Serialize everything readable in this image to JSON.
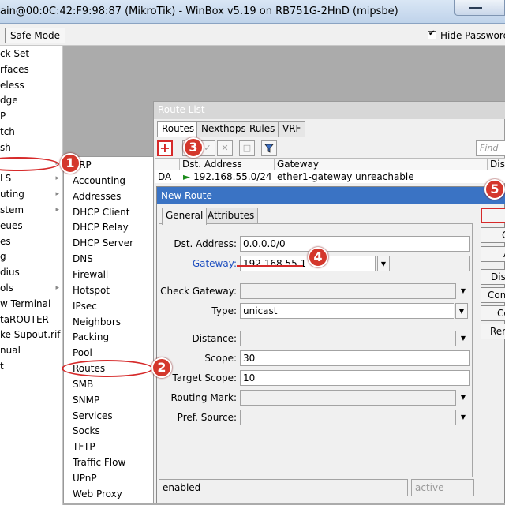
{
  "window": {
    "title": "ain@00:0C:42:F9:98:87 (MikroTik) - WinBox v5.19 on RB751G-2HnD (mipsbe)"
  },
  "toolbar": {
    "safe_mode": "Safe Mode",
    "hide_passwords": "Hide Password"
  },
  "sidebar": {
    "items": [
      {
        "label": "ck Set",
        "arrow": ""
      },
      {
        "label": "rfaces",
        "arrow": ""
      },
      {
        "label": "eless",
        "arrow": ""
      },
      {
        "label": "dge",
        "arrow": ""
      },
      {
        "label": "P",
        "arrow": ""
      },
      {
        "label": "tch",
        "arrow": ""
      },
      {
        "label": "sh",
        "arrow": ""
      },
      {
        "label": "",
        "arrow": "▸"
      },
      {
        "label": "LS",
        "arrow": "▸"
      },
      {
        "label": "uting",
        "arrow": "▸"
      },
      {
        "label": "stem",
        "arrow": "▸"
      },
      {
        "label": "eues",
        "arrow": ""
      },
      {
        "label": "es",
        "arrow": ""
      },
      {
        "label": "g",
        "arrow": ""
      },
      {
        "label": "dius",
        "arrow": ""
      },
      {
        "label": "ols",
        "arrow": "▸"
      },
      {
        "label": "w Terminal",
        "arrow": ""
      },
      {
        "label": "taROUTER",
        "arrow": ""
      },
      {
        "label": "ke Supout.rif",
        "arrow": ""
      },
      {
        "label": "nual",
        "arrow": ""
      },
      {
        "label": "t",
        "arrow": ""
      }
    ]
  },
  "submenu": {
    "items": [
      "ARP",
      "Accounting",
      "Addresses",
      "DHCP Client",
      "DHCP Relay",
      "DHCP Server",
      "DNS",
      "Firewall",
      "Hotspot",
      "IPsec",
      "Neighbors",
      "Packing",
      "Pool",
      "Routes",
      "SMB",
      "SNMP",
      "Services",
      "Socks",
      "TFTP",
      "Traffic Flow",
      "UPnP",
      "Web Proxy"
    ]
  },
  "route_list": {
    "title": "Route List",
    "tabs": [
      "Routes",
      "Nexthops",
      "Rules",
      "VRF"
    ],
    "find_placeholder": "Find",
    "columns": [
      "",
      "Dst. Address",
      "Gateway",
      "Dist"
    ],
    "rows": [
      {
        "flags": "DA",
        "dst": "192.168.55.0/24",
        "gateway": "ether1-gateway unreachable"
      }
    ]
  },
  "new_route": {
    "title": "New Route",
    "tabs": [
      "General",
      "Attributes"
    ],
    "fields": {
      "dst_address": {
        "label": "Dst. Address:",
        "value": "0.0.0.0/0"
      },
      "gateway": {
        "label": "Gateway:",
        "value": "192.168.55.1"
      },
      "check_gateway": {
        "label": "Check Gateway:",
        "value": ""
      },
      "type": {
        "label": "Type:",
        "value": "unicast"
      },
      "distance": {
        "label": "Distance:",
        "value": ""
      },
      "scope": {
        "label": "Scope:",
        "value": "30"
      },
      "target_scope": {
        "label": "Target Scope:",
        "value": "10"
      },
      "routing_mark": {
        "label": "Routing Mark:",
        "value": ""
      },
      "pref_source": {
        "label": "Pref. Source:",
        "value": ""
      }
    },
    "buttons": [
      "O",
      "Ca",
      "Ap",
      "Dis",
      "Com",
      "Co",
      "Rem"
    ],
    "status": {
      "left": "enabled",
      "right": "active"
    }
  },
  "annotations": {
    "b1": "1",
    "b2": "2",
    "b3": "3",
    "b4": "4",
    "b5": "5"
  },
  "colors": {
    "annotation": "#d62a2a",
    "titlebar_active": "#3a73c4",
    "link_label": "#1f4fbf"
  }
}
